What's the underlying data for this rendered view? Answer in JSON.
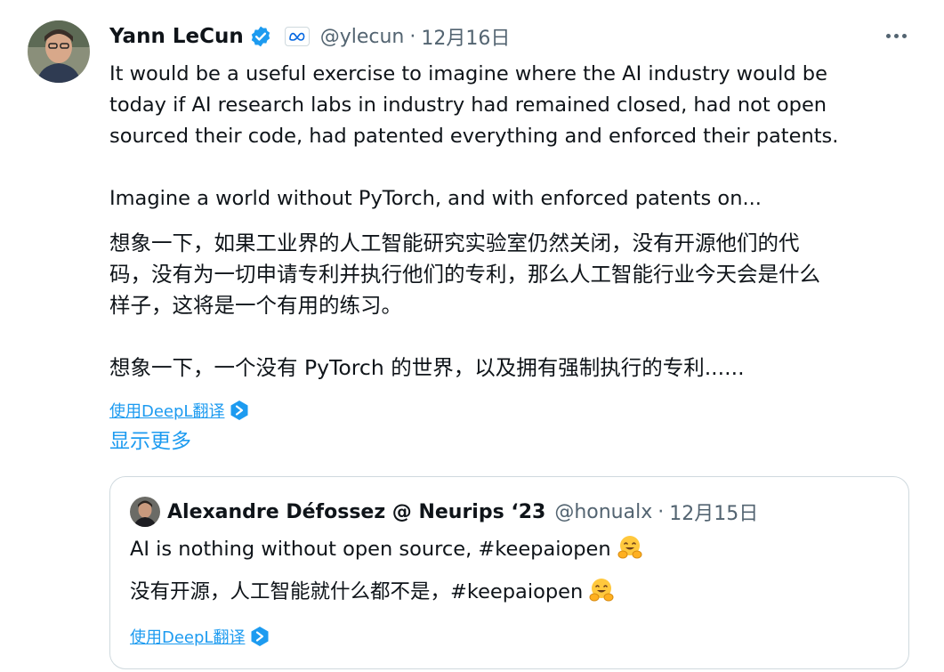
{
  "tweet": {
    "author_name": "Yann LeCun",
    "handle": "@ylecun",
    "separator": "·",
    "date": "12月16日",
    "text_en": [
      "It would be a useful exercise to imagine where the AI industry would be",
      "today if AI research labs in industry had remained closed, had not open",
      "sourced their code, had patented everything and enforced their patents."
    ],
    "text_en_2": "Imagine a world without PyTorch, and with enforced patents on...",
    "text_zh": [
      "想象一下，如果工业界的人工智能研究实验室仍然关闭，没有开源他们的代",
      "码，没有为一切申请专利并执行他们的专利，那么人工智能行业今天会是什么",
      "样子，这将是一个有用的练习。"
    ],
    "text_zh_2": "想象一下，一个没有 PyTorch 的世界，以及拥有强制执行的专利......",
    "translate_label": "使用DeepL翻译",
    "show_more_label": "显示更多"
  },
  "quoted_tweet": {
    "author_name": "Alexandre Défossez @ Neurips ‘23",
    "handle": "@honualx",
    "separator": "·",
    "date": "12月15日",
    "text_en": "AI is nothing without open source, #keepaiopen",
    "text_zh": "没有开源，人工智能就什么都不是，#keepaiopen",
    "translate_label": "使用DeepL翻译"
  },
  "colors": {
    "accent": "#1d9bf0",
    "secondary_text": "#536471",
    "primary_text": "#0f1419",
    "border": "#cfd9de"
  },
  "icons": [
    "verified-badge-icon",
    "meta-affiliate-icon",
    "more-options-icon",
    "deepl-icon",
    "hugging-face-emoji-icon"
  ]
}
